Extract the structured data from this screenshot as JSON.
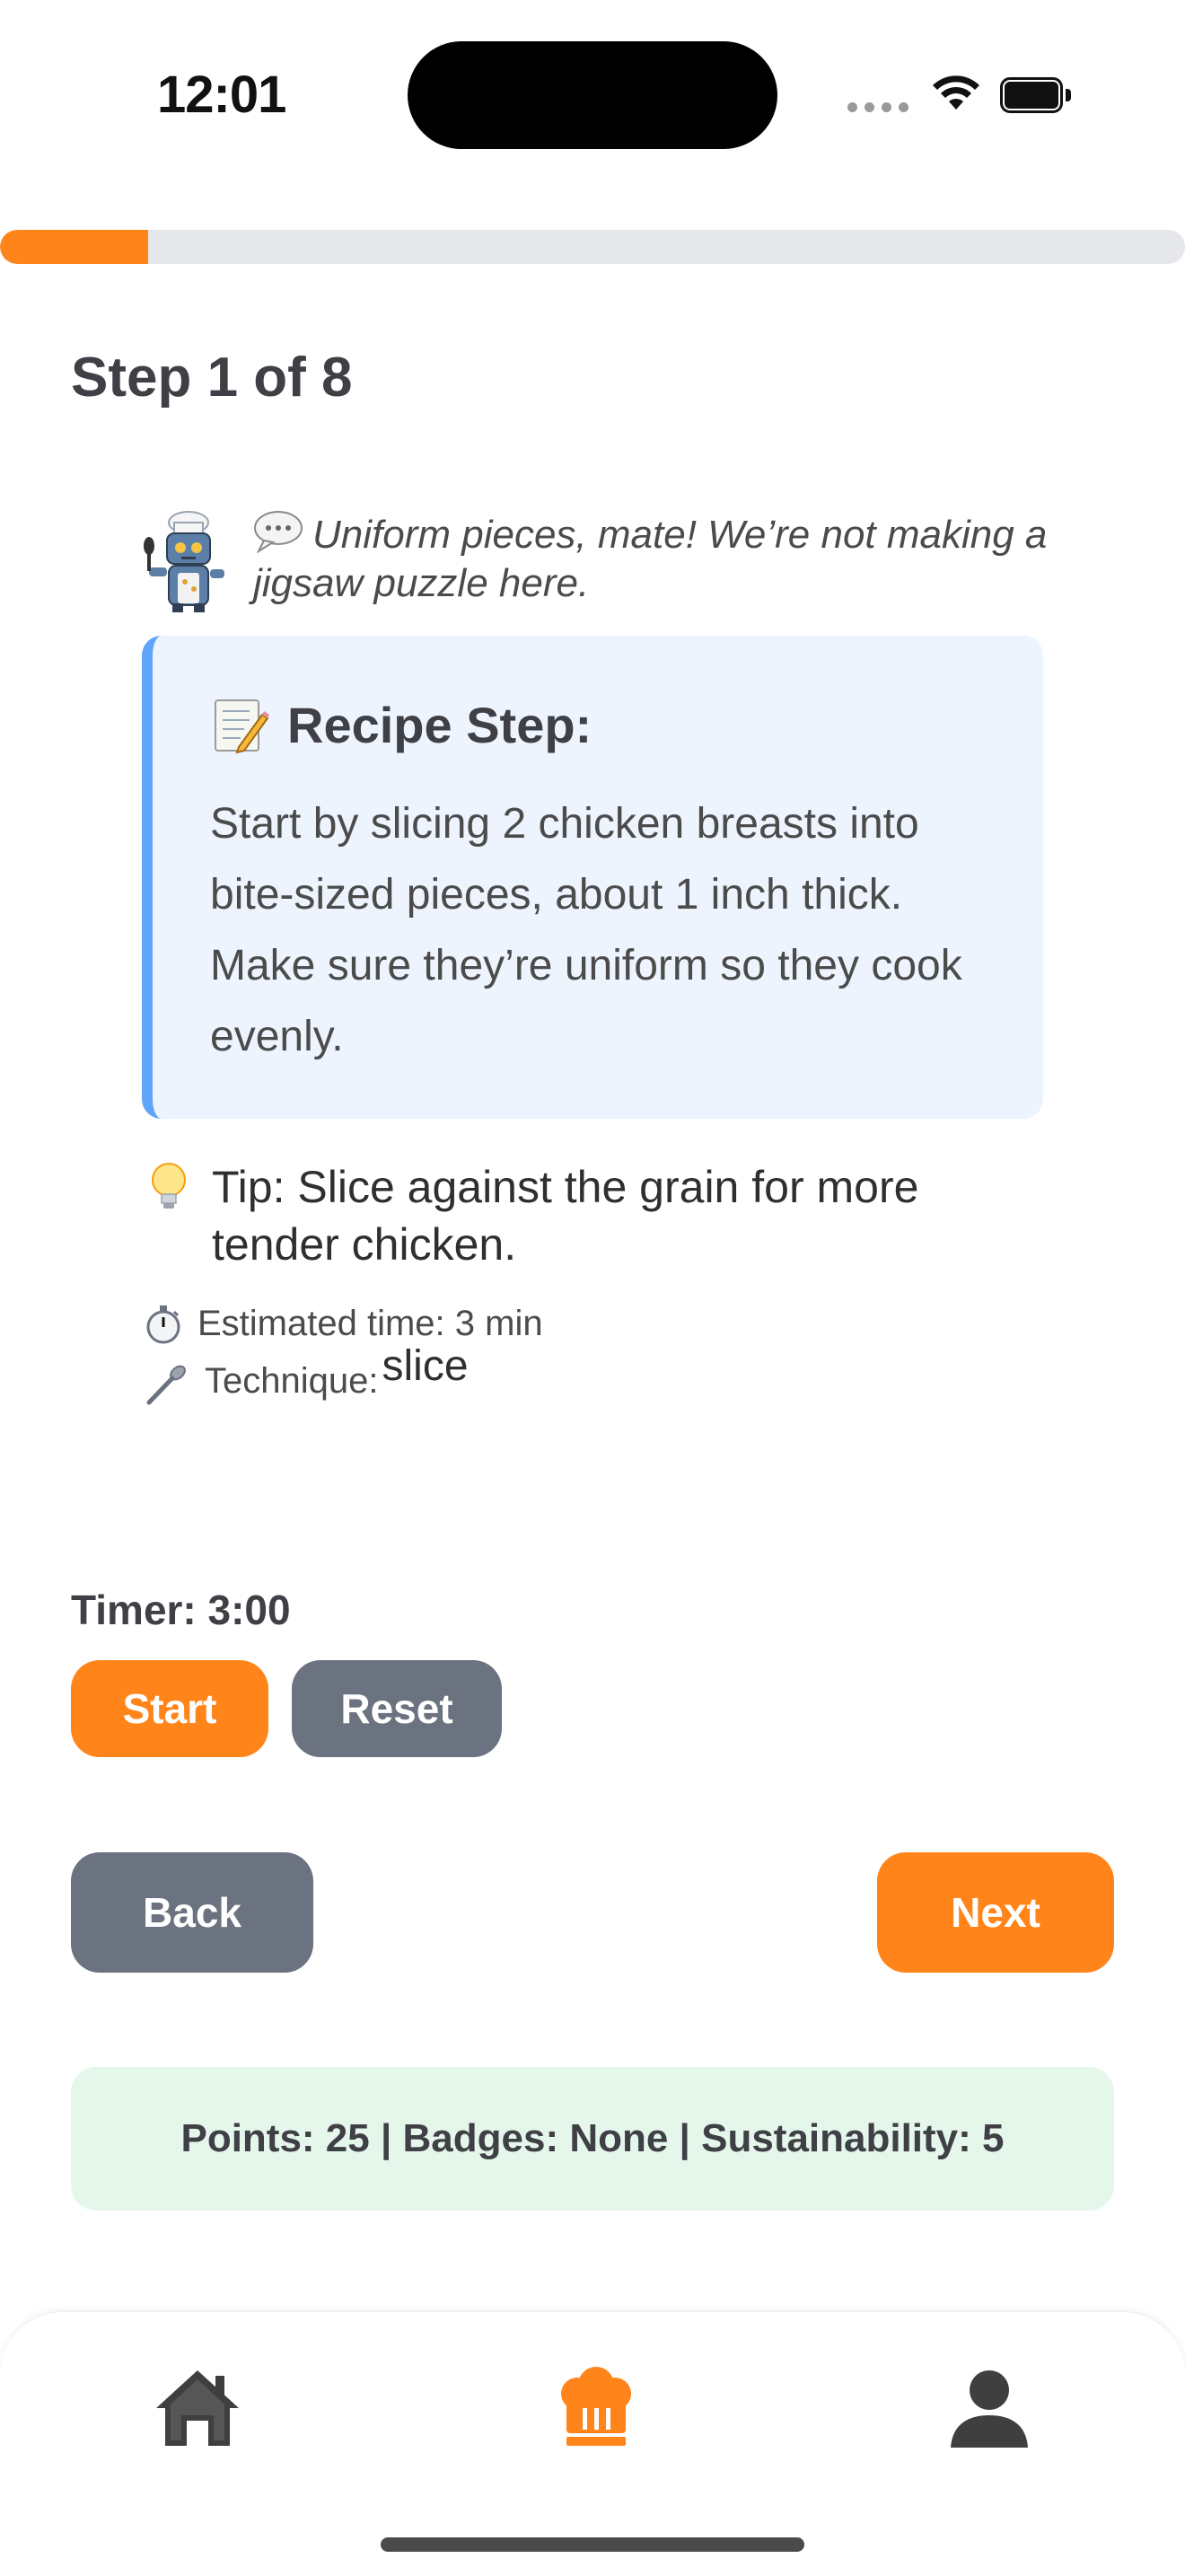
{
  "status_bar": {
    "time": "12:01"
  },
  "progress": {
    "current_step": 1,
    "total_steps": 8,
    "fraction": 0.125,
    "color": "#ff851b",
    "track_color": "#e6e7eb"
  },
  "step": {
    "title": "Step 1 of 8"
  },
  "chef": {
    "avatar_icon": "robot-chef-icon",
    "bubble_icon": "speech-bubble-icon",
    "quote": "Uniform pieces, mate! We’re not making a jigsaw puzzle here."
  },
  "recipe": {
    "heading_icon": "memo-icon",
    "heading": "Recipe Step:",
    "text": "Start by slicing 2 chicken breasts into bite-sized pieces, about 1 inch thick. Make sure they’re uniform so they cook evenly.",
    "accent_color": "#60a5fa",
    "background_color": "#eef4fe"
  },
  "tip": {
    "icon": "light-bulb-icon",
    "text": "Tip: Slice against the grain for more tender chicken."
  },
  "meta": {
    "time_icon": "stopwatch-icon",
    "estimated_time": "Estimated time: 3 min",
    "technique_icon": "spoon-icon",
    "technique_label": "Technique:",
    "technique_value": "slice"
  },
  "timer": {
    "label": "Timer: 3:00",
    "start_label": "Start",
    "reset_label": "Reset"
  },
  "navigation": {
    "back_label": "Back",
    "next_label": "Next"
  },
  "stats": {
    "text": "Points: 25 | Badges: None | Sustainability: 5",
    "background_color": "#e5f7eb"
  },
  "tab_bar": {
    "tabs": [
      {
        "icon": "home-icon",
        "active": false
      },
      {
        "icon": "chef-hat-icon",
        "active": true
      },
      {
        "icon": "person-icon",
        "active": false
      }
    ],
    "active_color": "#ff851b",
    "inactive_color": "#3f3f3f"
  },
  "colors": {
    "primary": "#ff851b",
    "secondary_button": "#6b7280"
  }
}
